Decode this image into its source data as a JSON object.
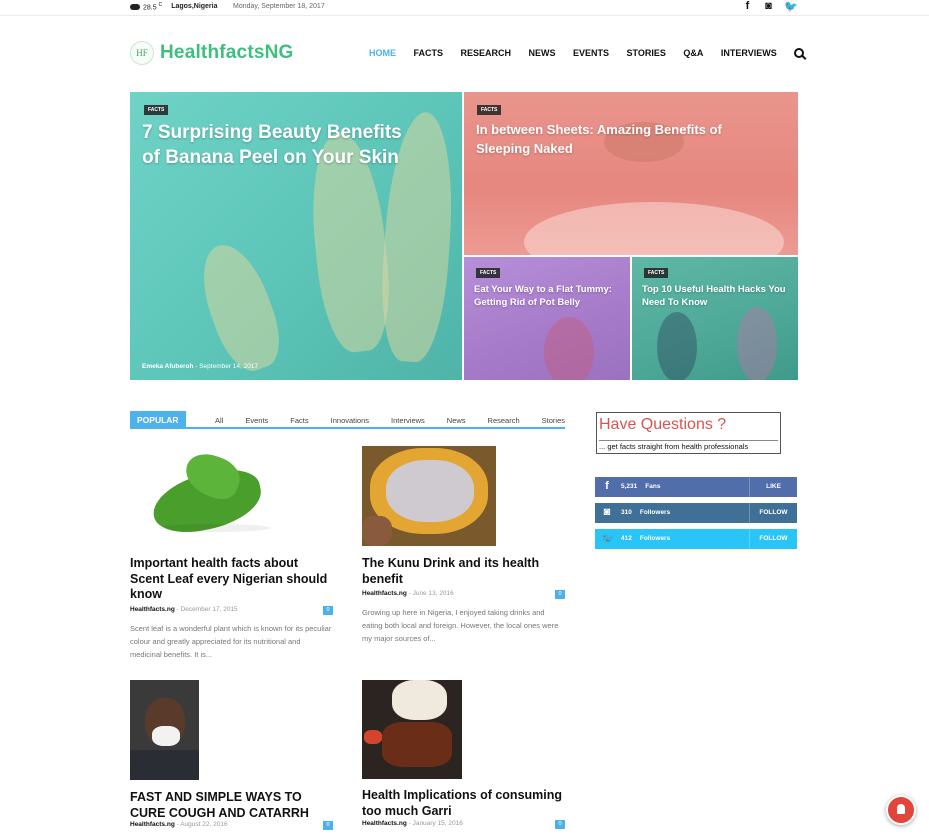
{
  "topbar": {
    "temp": "28.5",
    "temp_unit": "C",
    "location": "Lagos,Nigeria",
    "date": "Monday, September 18, 2017",
    "social_icons": [
      "facebook-icon",
      "instagram-icon",
      "twitter-icon"
    ]
  },
  "header": {
    "logo_mark": "HF",
    "site_name": "HealthfactsNG",
    "nav": [
      "HOME",
      "FACTS",
      "RESEARCH",
      "NEWS",
      "EVENTS",
      "STORIES",
      "Q&A",
      "INTERVIEWS"
    ],
    "active_nav": "HOME"
  },
  "hero": {
    "main": {
      "category": "FACTS",
      "title": "7 Surprising Beauty Benefits of Banana Peel on Your Skin",
      "author": "Emeka Afuberoh",
      "date": "September 14, 2017"
    },
    "top_right": {
      "category": "FACTS",
      "title": "In between Sheets: Amazing Benefits of Sleeping Naked"
    },
    "bottom_left": {
      "category": "FACTS",
      "title": "Eat Your Way to a Flat Tummy: Getting Rid of Pot Belly"
    },
    "bottom_right": {
      "category": "FACTS",
      "title": "Top 10 Useful Health Hacks You Need To Know"
    }
  },
  "popular": {
    "label": "POPULAR",
    "filters": [
      "All",
      "Events",
      "Facts",
      "Innovations",
      "Interviews",
      "News",
      "Research",
      "Stories"
    ],
    "cards": [
      {
        "title": "Important health facts about Scent Leaf every Nigerian should know",
        "author": "Healthfacts.ng",
        "date": "December 17, 2015",
        "comments": "0",
        "excerpt": "Scent leaf is a wonderful plant which is known for its peculiar colour and greatly appreciated for its nutritional and medicinal benefits. It is..."
      },
      {
        "title": "The Kunu Drink and its health benefit",
        "author": "Healthfacts.ng",
        "date": "June 13, 2016",
        "comments": "0",
        "excerpt": "Growing up here in Nigeria, I enjoyed taking drinks and eating both local and foreign. However, the local ones were my major sources of..."
      },
      {
        "title": "FAST AND SIMPLE WAYS TO CURE COUGH AND CATARRH",
        "author": "Healthfacts.ng",
        "date": "August 22, 2016",
        "comments": "0"
      },
      {
        "title": "Health Implications of consuming too much Garri",
        "author": "Healthfacts.ng",
        "date": "January 15, 2016",
        "comments": "0"
      }
    ]
  },
  "sidebar": {
    "ad_heading": "Have Questions ?",
    "ad_sub": "... get facts straight from health professionals",
    "social": [
      {
        "count": "5,231",
        "label": "Fans",
        "action": "LIKE",
        "icon": "facebook-icon",
        "color": "#516eab"
      },
      {
        "count": "310",
        "label": "Followers",
        "action": "FOLLOW",
        "icon": "instagram-icon",
        "color": "#417096"
      },
      {
        "count": "412",
        "label": "Followers",
        "action": "FOLLOW",
        "icon": "twitter-icon",
        "color": "#29c5f6"
      }
    ]
  },
  "colors": {
    "accent": "#4db2ec",
    "brand": "#3fbf7f"
  }
}
